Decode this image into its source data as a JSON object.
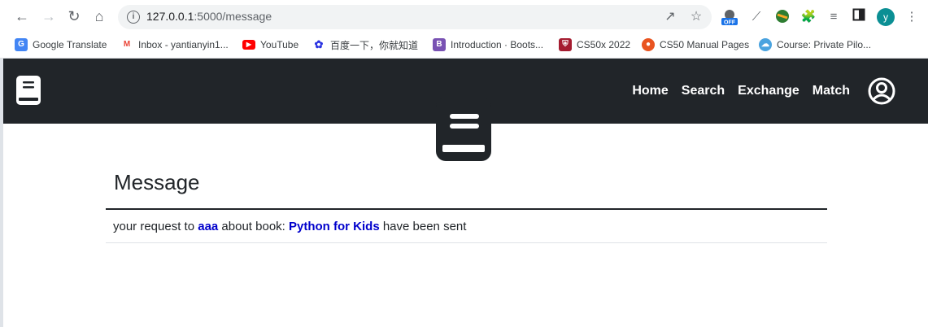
{
  "browser": {
    "url_host": "127.0.0.1",
    "url_path": ":5000/message",
    "avatar_letter": "y",
    "extension_badge": "OFF",
    "bookmarks": [
      {
        "label": "Google Translate",
        "icon": "google-translate-icon",
        "color": "#4285f4"
      },
      {
        "label": "Inbox - yantianyin1...",
        "icon": "gmail-icon",
        "color": "#ea4335"
      },
      {
        "label": "YouTube",
        "icon": "youtube-icon",
        "color": "#ff0000"
      },
      {
        "label": "百度一下，你就知道",
        "icon": "baidu-icon",
        "color": "#2932e1"
      },
      {
        "label": "Introduction · Boots...",
        "icon": "bootstrap-icon",
        "color": "#7952b3"
      },
      {
        "label": "CS50x 2022",
        "icon": "harvard-icon",
        "color": "#a51c30"
      },
      {
        "label": "CS50 Manual Pages",
        "icon": "ubuntu-icon",
        "color": "#e95420"
      },
      {
        "label": "Course: Private Pilo...",
        "icon": "cloud-icon",
        "color": "#4aa3df"
      }
    ]
  },
  "navbar": {
    "links": [
      "Home",
      "Search",
      "Exchange",
      "Match"
    ],
    "background": "#212529"
  },
  "content": {
    "title": "Message",
    "message": {
      "prefix": "your request to ",
      "user": "aaa",
      "middle": " about book: ",
      "book": "Python for Kids",
      "suffix": " have been sent"
    },
    "highlight_color": "#0000cc"
  }
}
